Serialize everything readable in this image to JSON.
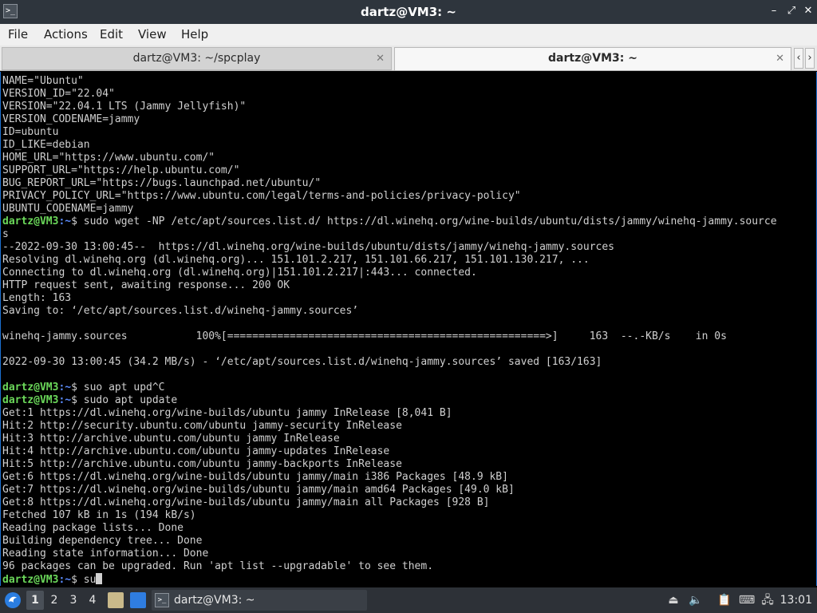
{
  "window": {
    "title": "dartz@VM3: ~",
    "minimize_glyph": "–",
    "maximize_glyph": "⤢",
    "close_glyph": "✕",
    "app_icon_glyph": ">_"
  },
  "menu": [
    "File",
    "Actions",
    "Edit",
    "View",
    "Help"
  ],
  "tabs": [
    {
      "label": "dartz@VM3: ~/spcplay",
      "active": false,
      "close": "✕"
    },
    {
      "label": "dartz@VM3: ~",
      "active": true,
      "close": "✕"
    }
  ],
  "tab_nav": {
    "prev": "‹",
    "next": "›"
  },
  "terminal": {
    "prompt_user": "dartz@VM3",
    "prompt_path": ":~",
    "prompt_symbol": "$ ",
    "lines": [
      {
        "text": "NAME=\"Ubuntu\""
      },
      {
        "text": "VERSION_ID=\"22.04\""
      },
      {
        "text": "VERSION=\"22.04.1 LTS (Jammy Jellyfish)\""
      },
      {
        "text": "VERSION_CODENAME=jammy"
      },
      {
        "text": "ID=ubuntu"
      },
      {
        "text": "ID_LIKE=debian"
      },
      {
        "text": "HOME_URL=\"https://www.ubuntu.com/\""
      },
      {
        "text": "SUPPORT_URL=\"https://help.ubuntu.com/\""
      },
      {
        "text": "BUG_REPORT_URL=\"https://bugs.launchpad.net/ubuntu/\""
      },
      {
        "text": "PRIVACY_POLICY_URL=\"https://www.ubuntu.com/legal/terms-and-policies/privacy-policy\""
      },
      {
        "text": "UBUNTU_CODENAME=jammy"
      },
      {
        "prompt": true,
        "text": "sudo wget -NP /etc/apt/sources.list.d/ https://dl.winehq.org/wine-builds/ubuntu/dists/jammy/winehq-jammy.source"
      },
      {
        "text": "s"
      },
      {
        "text": "--2022-09-30 13:00:45--  https://dl.winehq.org/wine-builds/ubuntu/dists/jammy/winehq-jammy.sources"
      },
      {
        "text": "Resolving dl.winehq.org (dl.winehq.org)... 151.101.2.217, 151.101.66.217, 151.101.130.217, ..."
      },
      {
        "text": "Connecting to dl.winehq.org (dl.winehq.org)|151.101.2.217|:443... connected."
      },
      {
        "text": "HTTP request sent, awaiting response... 200 OK"
      },
      {
        "text": "Length: 163"
      },
      {
        "text": "Saving to: ‘/etc/apt/sources.list.d/winehq-jammy.sources’"
      },
      {
        "text": ""
      },
      {
        "text": "winehq-jammy.sources           100%[===================================================>]     163  --.-KB/s    in 0s"
      },
      {
        "text": ""
      },
      {
        "text": "2022-09-30 13:00:45 (34.2 MB/s) - ‘/etc/apt/sources.list.d/winehq-jammy.sources’ saved [163/163]"
      },
      {
        "text": ""
      },
      {
        "prompt": true,
        "text": "suo apt upd^C"
      },
      {
        "prompt": true,
        "text": "sudo apt update"
      },
      {
        "text": "Get:1 https://dl.winehq.org/wine-builds/ubuntu jammy InRelease [8,041 B]"
      },
      {
        "text": "Hit:2 http://security.ubuntu.com/ubuntu jammy-security InRelease"
      },
      {
        "text": "Hit:3 http://archive.ubuntu.com/ubuntu jammy InRelease"
      },
      {
        "text": "Hit:4 http://archive.ubuntu.com/ubuntu jammy-updates InRelease"
      },
      {
        "text": "Hit:5 http://archive.ubuntu.com/ubuntu jammy-backports InRelease"
      },
      {
        "text": "Get:6 https://dl.winehq.org/wine-builds/ubuntu jammy/main i386 Packages [48.9 kB]"
      },
      {
        "text": "Get:7 https://dl.winehq.org/wine-builds/ubuntu jammy/main amd64 Packages [49.0 kB]"
      },
      {
        "text": "Get:8 https://dl.winehq.org/wine-builds/ubuntu jammy/main all Packages [928 B]"
      },
      {
        "text": "Fetched 107 kB in 1s (194 kB/s)"
      },
      {
        "text": "Reading package lists... Done"
      },
      {
        "text": "Building dependency tree... Done"
      },
      {
        "text": "Reading state information... Done"
      },
      {
        "text": "96 packages can be upgraded. Run 'apt list --upgradable' to see them."
      },
      {
        "prompt": true,
        "text": "su",
        "cursor": true
      }
    ]
  },
  "taskbar": {
    "workspaces": [
      "1",
      "2",
      "3",
      "4"
    ],
    "active_workspace": "1",
    "task_label": "dartz@VM3: ~",
    "task_icon_glyph": ">_",
    "tray": [
      {
        "name": "upload-icon",
        "glyph": "⏏"
      },
      {
        "name": "volume-icon",
        "glyph": "🔈"
      },
      {
        "name": "clipboard-icon",
        "glyph": "📋"
      },
      {
        "name": "keyboard-icon",
        "glyph": "⌨"
      },
      {
        "name": "network-icon",
        "glyph": "🖧"
      }
    ],
    "clock": "13:01"
  },
  "colors": {
    "terminal_bg": "#000000",
    "terminal_fg": "#d0d0d0",
    "prompt_user": "#6bd85a",
    "prompt_path": "#5b8cff",
    "titlebar_bg": "#2e353d",
    "taskbar_bg": "#2d3137"
  }
}
